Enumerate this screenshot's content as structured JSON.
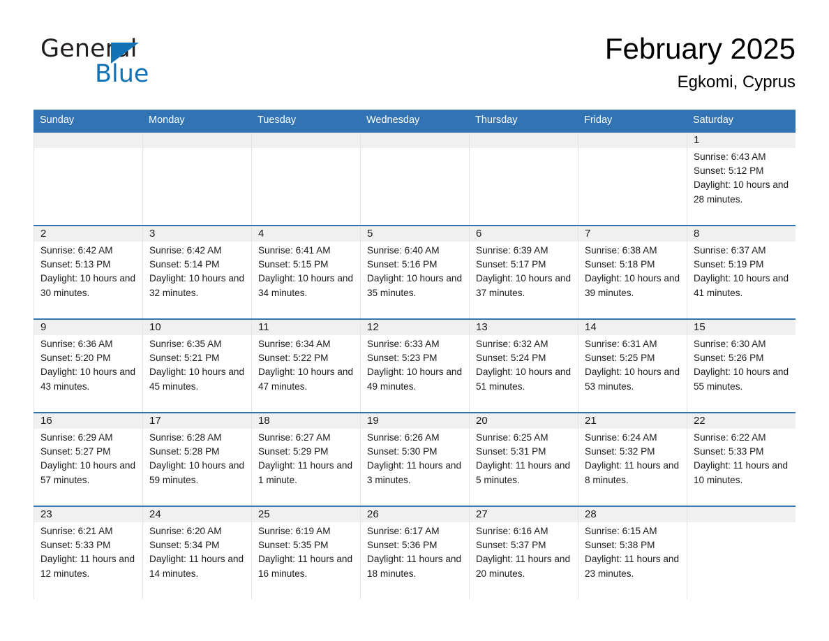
{
  "brand": {
    "name_part1": "General",
    "name_part2": "Blue",
    "accent_color": "#1272b6"
  },
  "header": {
    "title": "February 2025",
    "subtitle": "Egkomi, Cyprus"
  },
  "theme": {
    "header_blue": "#3273b3",
    "row_band_gray": "#f0f0f0",
    "text_color": "#1a1a1a"
  },
  "weekday_headers": [
    "Sunday",
    "Monday",
    "Tuesday",
    "Wednesday",
    "Thursday",
    "Friday",
    "Saturday"
  ],
  "labels": {
    "sunrise_prefix": "Sunrise:",
    "sunset_prefix": "Sunset:",
    "daylight_prefix": "Daylight:"
  },
  "weeks": [
    [
      {
        "day": "",
        "sunrise": "",
        "sunset": "",
        "daylight": ""
      },
      {
        "day": "",
        "sunrise": "",
        "sunset": "",
        "daylight": ""
      },
      {
        "day": "",
        "sunrise": "",
        "sunset": "",
        "daylight": ""
      },
      {
        "day": "",
        "sunrise": "",
        "sunset": "",
        "daylight": ""
      },
      {
        "day": "",
        "sunrise": "",
        "sunset": "",
        "daylight": ""
      },
      {
        "day": "",
        "sunrise": "",
        "sunset": "",
        "daylight": ""
      },
      {
        "day": "1",
        "sunrise": "Sunrise: 6:43 AM",
        "sunset": "Sunset: 5:12 PM",
        "daylight": "Daylight: 10 hours and 28 minutes."
      }
    ],
    [
      {
        "day": "2",
        "sunrise": "Sunrise: 6:42 AM",
        "sunset": "Sunset: 5:13 PM",
        "daylight": "Daylight: 10 hours and 30 minutes."
      },
      {
        "day": "3",
        "sunrise": "Sunrise: 6:42 AM",
        "sunset": "Sunset: 5:14 PM",
        "daylight": "Daylight: 10 hours and 32 minutes."
      },
      {
        "day": "4",
        "sunrise": "Sunrise: 6:41 AM",
        "sunset": "Sunset: 5:15 PM",
        "daylight": "Daylight: 10 hours and 34 minutes."
      },
      {
        "day": "5",
        "sunrise": "Sunrise: 6:40 AM",
        "sunset": "Sunset: 5:16 PM",
        "daylight": "Daylight: 10 hours and 35 minutes."
      },
      {
        "day": "6",
        "sunrise": "Sunrise: 6:39 AM",
        "sunset": "Sunset: 5:17 PM",
        "daylight": "Daylight: 10 hours and 37 minutes."
      },
      {
        "day": "7",
        "sunrise": "Sunrise: 6:38 AM",
        "sunset": "Sunset: 5:18 PM",
        "daylight": "Daylight: 10 hours and 39 minutes."
      },
      {
        "day": "8",
        "sunrise": "Sunrise: 6:37 AM",
        "sunset": "Sunset: 5:19 PM",
        "daylight": "Daylight: 10 hours and 41 minutes."
      }
    ],
    [
      {
        "day": "9",
        "sunrise": "Sunrise: 6:36 AM",
        "sunset": "Sunset: 5:20 PM",
        "daylight": "Daylight: 10 hours and 43 minutes."
      },
      {
        "day": "10",
        "sunrise": "Sunrise: 6:35 AM",
        "sunset": "Sunset: 5:21 PM",
        "daylight": "Daylight: 10 hours and 45 minutes."
      },
      {
        "day": "11",
        "sunrise": "Sunrise: 6:34 AM",
        "sunset": "Sunset: 5:22 PM",
        "daylight": "Daylight: 10 hours and 47 minutes."
      },
      {
        "day": "12",
        "sunrise": "Sunrise: 6:33 AM",
        "sunset": "Sunset: 5:23 PM",
        "daylight": "Daylight: 10 hours and 49 minutes."
      },
      {
        "day": "13",
        "sunrise": "Sunrise: 6:32 AM",
        "sunset": "Sunset: 5:24 PM",
        "daylight": "Daylight: 10 hours and 51 minutes."
      },
      {
        "day": "14",
        "sunrise": "Sunrise: 6:31 AM",
        "sunset": "Sunset: 5:25 PM",
        "daylight": "Daylight: 10 hours and 53 minutes."
      },
      {
        "day": "15",
        "sunrise": "Sunrise: 6:30 AM",
        "sunset": "Sunset: 5:26 PM",
        "daylight": "Daylight: 10 hours and 55 minutes."
      }
    ],
    [
      {
        "day": "16",
        "sunrise": "Sunrise: 6:29 AM",
        "sunset": "Sunset: 5:27 PM",
        "daylight": "Daylight: 10 hours and 57 minutes."
      },
      {
        "day": "17",
        "sunrise": "Sunrise: 6:28 AM",
        "sunset": "Sunset: 5:28 PM",
        "daylight": "Daylight: 10 hours and 59 minutes."
      },
      {
        "day": "18",
        "sunrise": "Sunrise: 6:27 AM",
        "sunset": "Sunset: 5:29 PM",
        "daylight": "Daylight: 11 hours and 1 minute."
      },
      {
        "day": "19",
        "sunrise": "Sunrise: 6:26 AM",
        "sunset": "Sunset: 5:30 PM",
        "daylight": "Daylight: 11 hours and 3 minutes."
      },
      {
        "day": "20",
        "sunrise": "Sunrise: 6:25 AM",
        "sunset": "Sunset: 5:31 PM",
        "daylight": "Daylight: 11 hours and 5 minutes."
      },
      {
        "day": "21",
        "sunrise": "Sunrise: 6:24 AM",
        "sunset": "Sunset: 5:32 PM",
        "daylight": "Daylight: 11 hours and 8 minutes."
      },
      {
        "day": "22",
        "sunrise": "Sunrise: 6:22 AM",
        "sunset": "Sunset: 5:33 PM",
        "daylight": "Daylight: 11 hours and 10 minutes."
      }
    ],
    [
      {
        "day": "23",
        "sunrise": "Sunrise: 6:21 AM",
        "sunset": "Sunset: 5:33 PM",
        "daylight": "Daylight: 11 hours and 12 minutes."
      },
      {
        "day": "24",
        "sunrise": "Sunrise: 6:20 AM",
        "sunset": "Sunset: 5:34 PM",
        "daylight": "Daylight: 11 hours and 14 minutes."
      },
      {
        "day": "25",
        "sunrise": "Sunrise: 6:19 AM",
        "sunset": "Sunset: 5:35 PM",
        "daylight": "Daylight: 11 hours and 16 minutes."
      },
      {
        "day": "26",
        "sunrise": "Sunrise: 6:17 AM",
        "sunset": "Sunset: 5:36 PM",
        "daylight": "Daylight: 11 hours and 18 minutes."
      },
      {
        "day": "27",
        "sunrise": "Sunrise: 6:16 AM",
        "sunset": "Sunset: 5:37 PM",
        "daylight": "Daylight: 11 hours and 20 minutes."
      },
      {
        "day": "28",
        "sunrise": "Sunrise: 6:15 AM",
        "sunset": "Sunset: 5:38 PM",
        "daylight": "Daylight: 11 hours and 23 minutes."
      },
      {
        "day": "",
        "sunrise": "",
        "sunset": "",
        "daylight": ""
      }
    ]
  ]
}
